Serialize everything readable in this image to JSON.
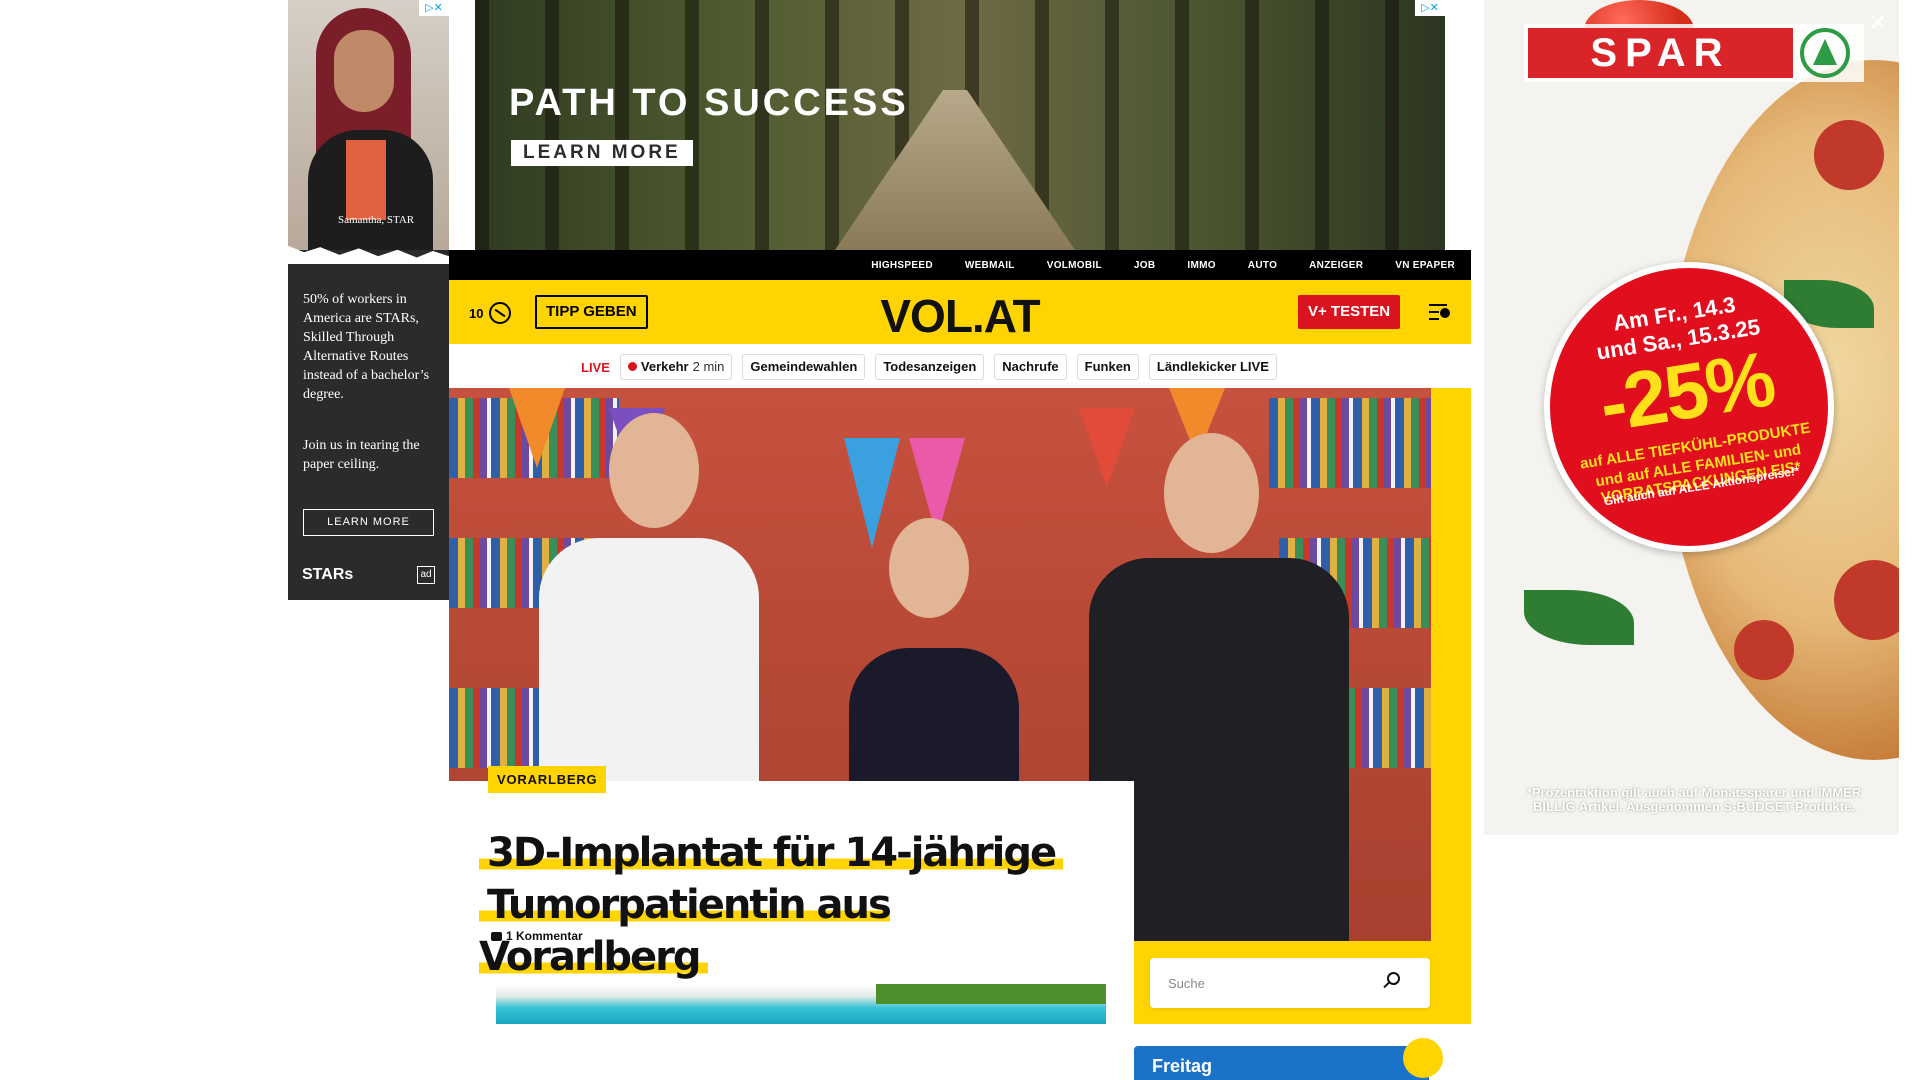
{
  "ads": {
    "left": {
      "caption": "Samantha, STAR",
      "copy_main": "50% of workers in America are STARs, Skilled Through Alternative Routes instead of a bachelor’s degree.",
      "copy_sub": "Join us in tearing the paper ceiling.",
      "cta": "LEARN MORE",
      "brand": "STARs",
      "badge": "ad"
    },
    "top": {
      "headline": "PATH TO SUCCESS",
      "cta": "LEARN MORE"
    },
    "right": {
      "brand": "SPAR",
      "date_line1": "Am Fr., 14.3",
      "date_line2": "und Sa., 15.3.25",
      "discount": "-25%",
      "line1": "auf ALLE TIEFKÜHL-PRODUKTE",
      "line2": "und auf ALLE FAMILIEN- und VORRATSPACKUNGEN EIS*",
      "line3": "Gilt auch auf ALLE Aktionspreise!*",
      "fine_print": "*Prozentaktion gilt auch auf Monatssparer und IMMER BILLIG Artikel. Ausgenommen S-BUDGET-Produkte.",
      "close": "✕"
    },
    "adchoices": "▷✕"
  },
  "utility_nav": [
    "HIGHSPEED",
    "WEBMAIL",
    "VOLMOBIL",
    "JOB",
    "IMMO",
    "AUTO",
    "ANZEIGER",
    "VN EPAPER"
  ],
  "header": {
    "temperature": "10",
    "tipp_label": "TIPP GEBEN",
    "logo": "VOL.AT",
    "vplus_label": "V+ TESTEN"
  },
  "quick_nav": {
    "live": "LIVE",
    "traffic_label": "Verkehr",
    "traffic_time": "2 min",
    "chips": [
      "Gemeindewahlen",
      "Todesanzeigen",
      "Nachrufe",
      "Funken",
      "Ländlekicker LIVE"
    ]
  },
  "article": {
    "tag": "VORARLBERG",
    "title_line1": "3D-Implantat für 14-jährige",
    "title_line2": "Tumorpatientin aus Vorarlberg",
    "comments": "1 Kommentar"
  },
  "search": {
    "placeholder": "Suche"
  },
  "widget": {
    "label": "Freitag"
  },
  "colors": {
    "brand_yellow": "#ffd400",
    "accent_red": "#d9141e",
    "black": "#000000"
  }
}
